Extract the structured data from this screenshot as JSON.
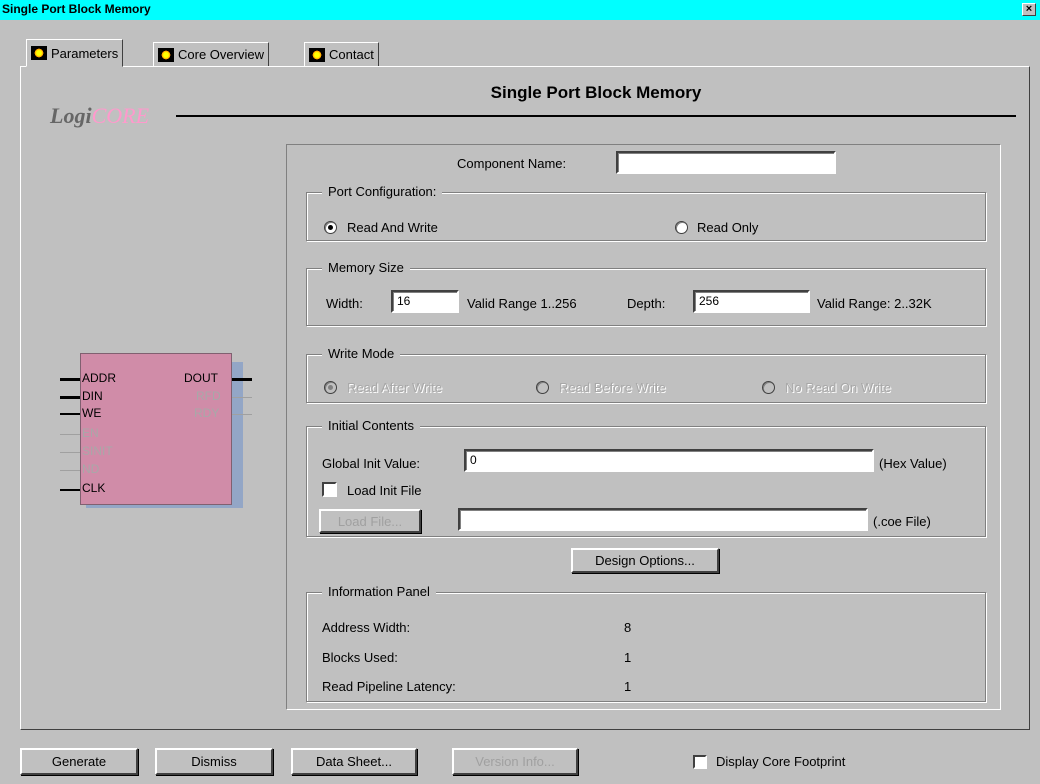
{
  "window": {
    "title": "Single Port Block Memory",
    "close_label": "×"
  },
  "tabs": [
    {
      "label": "Parameters",
      "active": true
    },
    {
      "label": "Core Overview",
      "active": false
    },
    {
      "label": "Contact",
      "active": false
    }
  ],
  "header": {
    "logo_prefix": "Logi",
    "logo_core": "CORE",
    "title": "Single Port Block Memory"
  },
  "symbol": {
    "left_pins": [
      "ADDR",
      "DIN",
      "WE",
      "EN",
      "SINIT",
      "ND",
      "CLK"
    ],
    "right_pins": [
      "DOUT",
      "RFD",
      "RDY"
    ]
  },
  "component": {
    "label": "Component Name:",
    "value": ""
  },
  "port_config": {
    "title": "Port Configuration:",
    "options": [
      {
        "label": "Read And Write",
        "checked": true
      },
      {
        "label": "Read Only",
        "checked": false
      }
    ]
  },
  "memory_size": {
    "title": "Memory Size",
    "width_label": "Width:",
    "width_value": "16",
    "width_range": "Valid Range 1..256",
    "depth_label": "Depth:",
    "depth_value": "256",
    "depth_range": "Valid Range: 2..32K"
  },
  "write_mode": {
    "title": "Write Mode",
    "options": [
      {
        "label": "Read After Write",
        "checked": true
      },
      {
        "label": "Read Before Write",
        "checked": false
      },
      {
        "label": "No Read On Write",
        "checked": false
      }
    ]
  },
  "initial_contents": {
    "title": "Initial Contents",
    "global_init_label": "Global Init Value:",
    "global_init_value": "0",
    "hex_label": "(Hex Value)",
    "load_init_label": "Load Init File",
    "load_file_button": "Load File...",
    "load_file_value": "",
    "coe_label": "(.coe File)"
  },
  "design_options_button": "Design Options...",
  "info_panel": {
    "title": "Information Panel",
    "rows": [
      {
        "label": "Address Width:",
        "value": "8"
      },
      {
        "label": "Blocks Used:",
        "value": "1"
      },
      {
        "label": "Read Pipeline Latency:",
        "value": "1"
      }
    ]
  },
  "footer": {
    "generate": "Generate",
    "dismiss": "Dismiss",
    "data_sheet": "Data Sheet...",
    "version_info": "Version Info...",
    "display_footprint": "Display Core Footprint"
  }
}
